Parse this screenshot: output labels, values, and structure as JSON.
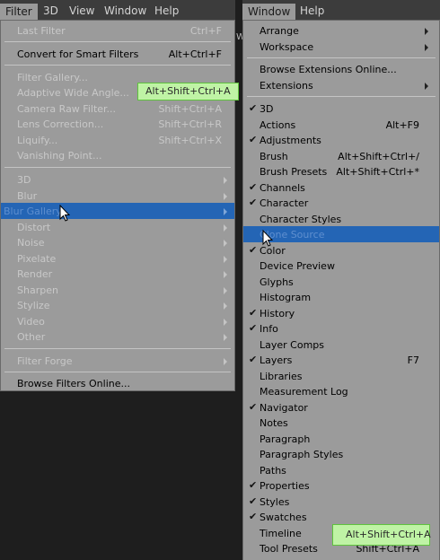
{
  "left_menubar": {
    "items": [
      "Filter",
      "3D",
      "View",
      "Window",
      "Help"
    ]
  },
  "right_menubar": {
    "items": [
      "Window",
      "Help"
    ]
  },
  "filter_menu": {
    "last_filter": {
      "label": "Last Filter",
      "shortcut": "Ctrl+F"
    },
    "convert": {
      "label": "Convert for Smart Filters",
      "shortcut": "Alt+Ctrl+F"
    },
    "gallery": [
      {
        "label": "Filter Gallery...",
        "shortcut": ""
      },
      {
        "label": "Adaptive Wide Angle...",
        "shortcut": ""
      },
      {
        "label": "Camera Raw Filter...",
        "shortcut": "Shift+Ctrl+A"
      },
      {
        "label": "Lens Correction...",
        "shortcut": "Shift+Ctrl+R"
      },
      {
        "label": "Liquify...",
        "shortcut": "Shift+Ctrl+X"
      },
      {
        "label": "Vanishing Point...",
        "shortcut": ""
      }
    ],
    "submenus": [
      "3D",
      "Blur",
      "Blur Gallery",
      "Distort",
      "Noise",
      "Pixelate",
      "Render",
      "Sharpen",
      "Stylize",
      "Video",
      "Other"
    ],
    "filter_forge": "Filter Forge",
    "browse": "Browse Filters Online..."
  },
  "filter_tooltip": "Alt+Shift+Ctrl+A",
  "partial_letter": "W",
  "window_menu": {
    "top_items": [
      "Arrange",
      "Workspace"
    ],
    "browse_extensions": "Browse Extensions Online...",
    "extensions": "Extensions",
    "check_mark": "✔",
    "panels": [
      {
        "label": "3D",
        "shortcut": "",
        "checked": true
      },
      {
        "label": "Actions",
        "shortcut": "Alt+F9",
        "checked": false
      },
      {
        "label": "Adjustments",
        "shortcut": "",
        "checked": true
      },
      {
        "label": "Brush",
        "shortcut": "Alt+Shift+Ctrl+/",
        "checked": false
      },
      {
        "label": "Brush Presets",
        "shortcut": "Alt+Shift+Ctrl+*",
        "checked": false
      },
      {
        "label": "Channels",
        "shortcut": "",
        "checked": true
      },
      {
        "label": "Character",
        "shortcut": "",
        "checked": true
      },
      {
        "label": "Character Styles",
        "shortcut": "",
        "checked": false
      },
      {
        "label": "Clone Source",
        "shortcut": "",
        "checked": false
      },
      {
        "label": "Color",
        "shortcut": "",
        "checked": true
      },
      {
        "label": "Device Preview",
        "shortcut": "",
        "checked": false
      },
      {
        "label": "Glyphs",
        "shortcut": "",
        "checked": false
      },
      {
        "label": "Histogram",
        "shortcut": "",
        "checked": false
      },
      {
        "label": "History",
        "shortcut": "",
        "checked": true
      },
      {
        "label": "Info",
        "shortcut": "",
        "checked": true
      },
      {
        "label": "Layer Comps",
        "shortcut": "",
        "checked": false
      },
      {
        "label": "Layers",
        "shortcut": "F7",
        "checked": true
      },
      {
        "label": "Libraries",
        "shortcut": "",
        "checked": false
      },
      {
        "label": "Measurement Log",
        "shortcut": "",
        "checked": false
      },
      {
        "label": "Navigator",
        "shortcut": "",
        "checked": true
      },
      {
        "label": "Notes",
        "shortcut": "",
        "checked": false
      },
      {
        "label": "Paragraph",
        "shortcut": "",
        "checked": false
      },
      {
        "label": "Paragraph Styles",
        "shortcut": "",
        "checked": false
      },
      {
        "label": "Paths",
        "shortcut": "",
        "checked": false
      },
      {
        "label": "Properties",
        "shortcut": "",
        "checked": true
      },
      {
        "label": "Styles",
        "shortcut": "",
        "checked": true
      },
      {
        "label": "Swatches",
        "shortcut": "",
        "checked": true
      },
      {
        "label": "Timeline",
        "shortcut": "",
        "checked": false
      },
      {
        "label": "Tool Presets",
        "shortcut": "Shift+Ctrl+A",
        "checked": false
      }
    ]
  },
  "window_tooltip": "Alt+Shift+Ctrl+A"
}
